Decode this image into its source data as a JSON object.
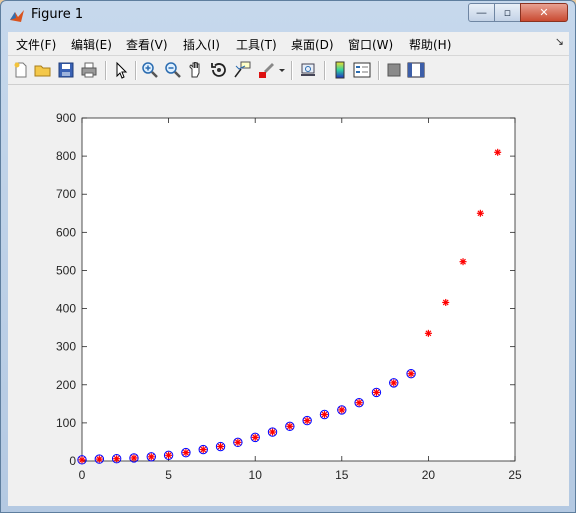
{
  "window": {
    "title": "Figure 1",
    "controls": {
      "minimize": "—",
      "maximize": "▫",
      "close": "✕"
    }
  },
  "menubar": {
    "items": [
      {
        "label": "文件(F)"
      },
      {
        "label": "编辑(E)"
      },
      {
        "label": "查看(V)"
      },
      {
        "label": "插入(I)"
      },
      {
        "label": "工具(T)"
      },
      {
        "label": "桌面(D)"
      },
      {
        "label": "窗口(W)"
      },
      {
        "label": "帮助(H)"
      }
    ]
  },
  "toolbar": {
    "icons": [
      "new-figure-icon",
      "open-file-icon",
      "save-icon",
      "print-icon",
      "edit-plot-arrow-icon",
      "zoom-in-icon",
      "zoom-out-icon",
      "pan-hand-icon",
      "rotate-3d-icon",
      "data-cursor-icon",
      "brush-icon",
      "brush-dropdown-icon",
      "link-plot-icon",
      "colorbar-icon",
      "legend-icon",
      "hide-plot-tools-icon",
      "show-plot-tools-icon"
    ]
  },
  "chart_data": {
    "type": "scatter",
    "title": "",
    "xlabel": "",
    "ylabel": "",
    "xlim": [
      0,
      25
    ],
    "ylim": [
      0,
      900
    ],
    "xticks": [
      0,
      5,
      10,
      15,
      20,
      25
    ],
    "yticks": [
      0,
      100,
      200,
      300,
      400,
      500,
      600,
      700,
      800,
      900
    ],
    "grid": false,
    "series": [
      {
        "marker": "circle",
        "color": "#0000ff",
        "x": [
          0,
          1,
          2,
          3,
          4,
          5,
          6,
          7,
          8,
          9,
          10,
          11,
          12,
          13,
          14,
          15,
          16,
          17,
          18,
          19
        ],
        "y": [
          3,
          5,
          6,
          8,
          11,
          15,
          22,
          30,
          38,
          49,
          62,
          76,
          91,
          106,
          122,
          134,
          153,
          180,
          205,
          229
        ]
      },
      {
        "marker": "asterisk",
        "color": "#ff0000",
        "x": [
          0,
          1,
          2,
          3,
          4,
          5,
          6,
          7,
          8,
          9,
          10,
          11,
          12,
          13,
          14,
          15,
          16,
          17,
          18,
          19,
          20,
          21,
          22,
          23,
          24
        ],
        "y": [
          3,
          5,
          6,
          8,
          11,
          15,
          22,
          30,
          38,
          49,
          62,
          76,
          91,
          106,
          122,
          134,
          153,
          180,
          205,
          229,
          335,
          416,
          523,
          650,
          810
        ]
      }
    ]
  }
}
